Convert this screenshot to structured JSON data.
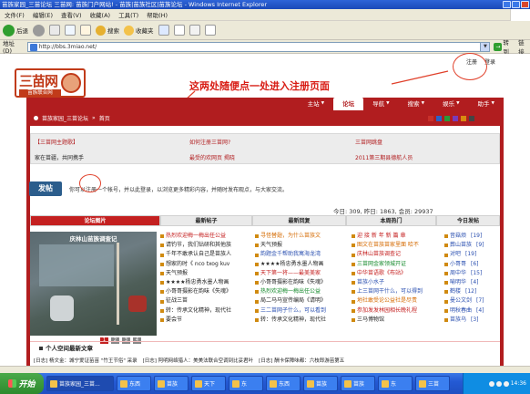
{
  "browser": {
    "title": "苗族家园_三苗论坛 三苗网: 苗族门户网站! - 苗族|苗族社区|苗族论坛 - Windows Internet Explorer",
    "menu": [
      "文件(F)",
      "编辑(E)",
      "查看(V)",
      "收藏(A)",
      "工具(T)",
      "帮助(H)"
    ],
    "toolbar": {
      "back": "后退",
      "search": "搜索",
      "favorites": "收藏夹"
    },
    "address_label": "地址(D)",
    "address": "http://bbs.3miao.net/",
    "go": "转到",
    "links": "链接"
  },
  "page": {
    "logo_text": "三苗网",
    "logo_sub": "苗族联合网",
    "register": "注册",
    "login": "登录",
    "annotation": "这两处随便点一处进入注册页面",
    "nav": [
      {
        "label": "主站",
        "active": false,
        "dropdown": true
      },
      {
        "label": "论坛",
        "active": true,
        "dropdown": false
      },
      {
        "label": "导航",
        "active": false,
        "dropdown": true
      },
      {
        "label": "搜索",
        "active": false,
        "dropdown": true
      },
      {
        "label": "娱乐",
        "active": false,
        "dropdown": true
      },
      {
        "label": "助手",
        "active": false,
        "dropdown": true
      }
    ],
    "breadcrumb": [
      "苗族家园_三苗论坛",
      "»",
      "首页"
    ],
    "theme_colors": [
      "#c8302a",
      "#2a62c8",
      "#2a9a3a",
      "#7a3ab8",
      "#d88a10",
      "#444444"
    ],
    "info": [
      {
        "link": "【三苗网主题歌】",
        "text": "家在苗疆，共同携手"
      },
      {
        "link": "如何注册三苗网?",
        "text": "最受的欢网页 揭晓"
      },
      {
        "link": "三苗网跳盘",
        "text": "2011第三期县德航人员"
      }
    ],
    "post_button": "发帖",
    "post_prompt": "你可以注册一个帐号，并以此登录，以浏览更多精彩内容，并随时发布观点，与大家交流。",
    "stats": "今日: 309, 昨日: 1863, 会员: 29937",
    "columns": [
      "论坛图片",
      "最新帖子",
      "最新回复",
      "本周热门",
      "今日发帖"
    ],
    "photo_caption": "庆林山苗族调查记",
    "photo_pages": [
      "1",
      "2",
      "3",
      "4"
    ],
    "new_posts": [
      {
        "text": "热烈欢迎梅一梅出任公益",
        "color": "t-red"
      },
      {
        "text": "请钓节，我们钻研和其他族",
        "color": "t-dark"
      },
      {
        "text": "千年不敢承认自己是苗族人",
        "color": "t-dark"
      },
      {
        "text": "想家的时《 nco txog kuv",
        "color": "t-dark"
      },
      {
        "text": "天气预报",
        "color": "t-dark"
      },
      {
        "text": "★★★★杨忠勇水墨人物画",
        "color": "t-dark"
      },
      {
        "text": "小哥哥摄影在韵味《失魂》",
        "color": "t-dark"
      },
      {
        "text": "征战三苗",
        "color": "t-dark"
      },
      {
        "text": "转：传承文化精神，现代社",
        "color": "t-dark"
      },
      {
        "text": "要会节",
        "color": "t-dark"
      }
    ],
    "new_replies": [
      {
        "text": "寻怪替翅，为什么苗族文",
        "color": "t-orange"
      },
      {
        "text": "天气预报",
        "color": "t-dark"
      },
      {
        "text": "韵题金千帮助我寓海龙湾",
        "color": "t-blue"
      },
      {
        "text": "★★★★杨忠勇水墨人物画",
        "color": "t-dark"
      },
      {
        "text": "天下第一将——最美美家",
        "color": "t-red"
      },
      {
        "text": "小哥哥摄影在韵味《失魂》",
        "color": "t-dark"
      },
      {
        "text": "热烈欢迎梅一梅出任公益",
        "color": "t-green"
      },
      {
        "text": "局二马马宣传编局《请明》",
        "color": "t-dark"
      },
      {
        "text": "三二苗网子什么，可以看到",
        "color": "t-blue"
      },
      {
        "text": "转：传承文化精神，现代社",
        "color": "t-dark"
      }
    ],
    "hot_posts": [
      {
        "text": "迎 接 新 年 新 篇 章",
        "color": "t-red"
      },
      {
        "text": "图文在苗族苗家里面 哈不",
        "color": "t-orange"
      },
      {
        "text": "庆林山苗族调查记",
        "color": "t-red"
      },
      {
        "text": "三苗网金家领城开证",
        "color": "t-green"
      },
      {
        "text": "中华苗语歌《布站》",
        "color": "t-red"
      },
      {
        "text": "苗族小水子",
        "color": "t-blue"
      },
      {
        "text": "上三苗网干什么，可以得到",
        "color": "t-blue"
      },
      {
        "text": "地社敢受论公益社是尽责",
        "color": "t-orange"
      },
      {
        "text": "参加发发林园相长晚礼程",
        "color": "t-red"
      },
      {
        "text": "三马博物馆",
        "color": "t-dark"
      }
    ],
    "today_posts": [
      {
        "text": "音菇烦",
        "count": "[19]"
      },
      {
        "text": "葬山苗族",
        "count": "[9]"
      },
      {
        "text": "对吧",
        "count": "[19]"
      },
      {
        "text": "小哥哥",
        "count": "[6]"
      },
      {
        "text": "周中华",
        "count": "[15]"
      },
      {
        "text": "喻明华",
        "count": "[4]"
      },
      {
        "text": "鹤楼",
        "count": "[12]"
      },
      {
        "text": "曼公文剑",
        "count": "[7]"
      },
      {
        "text": "明秋春曲",
        "count": "[4]"
      },
      {
        "text": "苗族乌",
        "count": "[3]"
      }
    ],
    "bottom_head": "个人空间最新文章",
    "bottom_row": [
      "[日志] 杨文金：城宁爱证苗苗 \"竹王节俗\" 采录",
      "[日志] 阿明网络猎人：美美法联合空调到比妥君叶",
      "[日志] 酬卡保障味都：六枝郎游苗第五"
    ]
  },
  "taskbar": {
    "start": "开始",
    "tasks": [
      "苗族家园_三苗...",
      "东西",
      "苗族",
      "天下",
      "东",
      "东西",
      "苗族",
      "苗族",
      "东",
      "三苗"
    ],
    "clock": "14:36"
  }
}
